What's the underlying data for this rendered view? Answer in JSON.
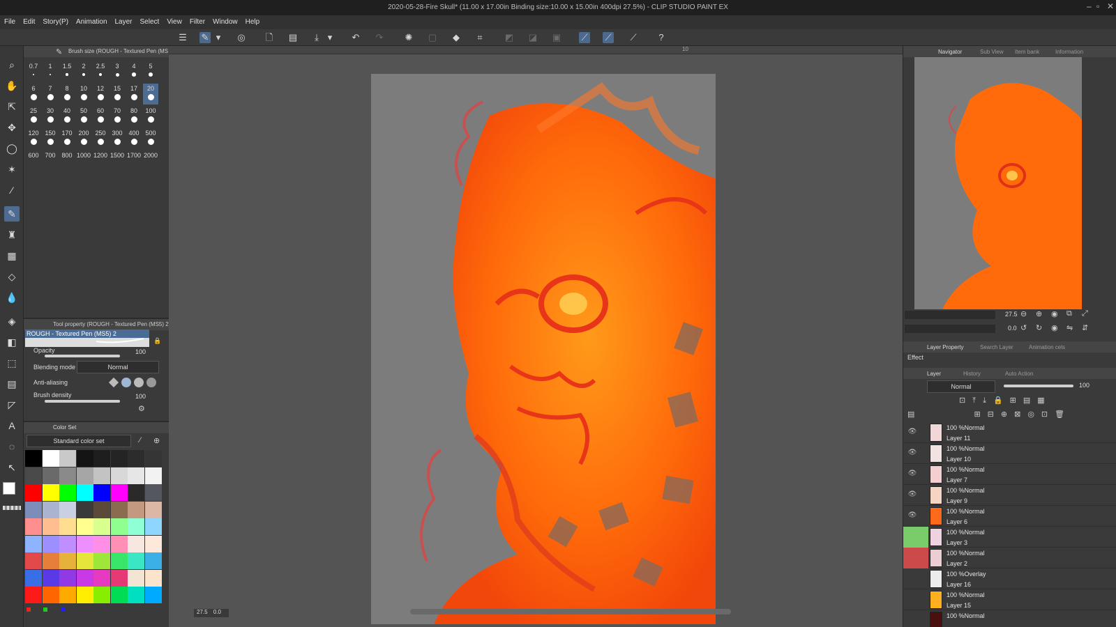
{
  "window": {
    "title": "2020-05-28-Fire Skull* (11.00 x 17.00in Binding size:10.00 x 15.00in 400dpi 27.5%) - CLIP STUDIO PAINT EX"
  },
  "menu": [
    "File",
    "Edit",
    "Story(P)",
    "Animation",
    "Layer",
    "Select",
    "View",
    "Filter",
    "Window",
    "Help"
  ],
  "brush_size_panel": {
    "title": "Brush size (ROUGH - Textured Pen (MS",
    "rows": [
      [
        "0.7",
        "1",
        "1.5",
        "2",
        "2.5",
        "3",
        "4",
        "5"
      ],
      [
        "6",
        "7",
        "8",
        "10",
        "12",
        "15",
        "17",
        "20"
      ],
      [
        "25",
        "30",
        "40",
        "50",
        "60",
        "70",
        "80",
        "100"
      ],
      [
        "120",
        "150",
        "170",
        "200",
        "250",
        "300",
        "400",
        "500"
      ],
      [
        "600",
        "700",
        "800",
        "1000",
        "1200",
        "1500",
        "1700",
        "2000"
      ]
    ],
    "selected": "20"
  },
  "tool_property": {
    "title": "Tool property (ROUGH - Textured Pen (MS5) 2)",
    "brush_name": "ROUGH - Textured Pen (MS5) 2",
    "opacity_label": "Opacity",
    "opacity_value": "100",
    "blending_label": "Blending mode",
    "blending_value": "Normal",
    "antialias_label": "Anti-aliasing",
    "density_label": "Brush density",
    "density_value": "100"
  },
  "color_set": {
    "tab": "Color Set",
    "set_name": "Standard color set",
    "rows": [
      [
        "#000000",
        "#ffffff",
        "#c9c9c9",
        "#141414",
        "#1e1e1e",
        "#242424",
        "#2c2c2c",
        "#353535"
      ],
      [
        "#4a4a4a",
        "#6a6a6a",
        "#8a8a8a",
        "#a6a6a6",
        "#c3c3c3",
        "#d8d8d8",
        "#e6e6e6",
        "#f2f2f2"
      ],
      [
        "#ff0000",
        "#ffff00",
        "#00ff00",
        "#00ffff",
        "#0000ff",
        "#ff00ff",
        "#2a2a2a",
        "#55575e"
      ],
      [
        "#7b8db8",
        "#aab3cf",
        "#c9d0e2",
        "#3a3a3a",
        "#5b4a3a",
        "#8a6c50",
        "#c39a80",
        "#dcb7a6"
      ],
      [
        "#ff8f8f",
        "#ffbe8f",
        "#ffdf8f",
        "#ffff8f",
        "#d9ff8f",
        "#8fff8f",
        "#8fffd6",
        "#8fd6ff"
      ],
      [
        "#8fb4ff",
        "#9d8fff",
        "#c08fff",
        "#ef8fff",
        "#ff8fe6",
        "#ff8fb5",
        "#f8e6e1",
        "#fde8dc"
      ],
      [
        "#e24a4a",
        "#e67f3a",
        "#e6b23a",
        "#e6e63a",
        "#9ee63a",
        "#3ae66a",
        "#3ae6c4",
        "#3ab0e6"
      ],
      [
        "#3a6ee6",
        "#5a3ae6",
        "#903ae6",
        "#c83ae6",
        "#e63ac0",
        "#e63a74",
        "#f4e4d4",
        "#fbe3cc"
      ],
      [
        "#ff1a1a",
        "#ff6600",
        "#ffaa00",
        "#ffee00",
        "#88ee00",
        "#00dd55",
        "#00e0c0",
        "#00aaff"
      ]
    ]
  },
  "canvas": {
    "zoom_readout": "27.5",
    "angle_readout": "0.0",
    "ruler_mark": "10"
  },
  "navigator": {
    "tabs": [
      "Navigator",
      "Sub View",
      "Item bank",
      "Information"
    ],
    "zoom": "27.5",
    "angle": "0.0"
  },
  "layer_property": {
    "tabs": [
      "Layer Property",
      "Search Layer",
      "Animation cels"
    ],
    "effect_label": "Effect"
  },
  "layer_panel": {
    "tabs": [
      "Layer",
      "History",
      "Auto Action"
    ],
    "blend_mode": "Normal",
    "opacity": "100",
    "layers": [
      {
        "mode": "100 %Normal",
        "name": "Layer 11",
        "thumb": "#f0d8d8"
      },
      {
        "mode": "100 %Normal",
        "name": "Layer 10",
        "thumb": "#f2e2e2"
      },
      {
        "mode": "100 %Normal",
        "name": "Layer 7",
        "thumb": "#f3cfcf"
      },
      {
        "mode": "100 %Normal",
        "name": "Layer 9",
        "thumb": "#f6d4c4"
      },
      {
        "mode": "100 %Normal",
        "name": "Layer 6",
        "thumb": "#ff6a1a"
      },
      {
        "mode": "100 %Normal",
        "name": "Layer 3",
        "thumb": "#efd2e0"
      },
      {
        "mode": "100 %Normal",
        "name": "Layer 2",
        "thumb": "#eccdd2"
      },
      {
        "mode": "100 %Overlay",
        "name": "Layer 16",
        "thumb": "#ececec"
      },
      {
        "mode": "100 %Normal",
        "name": "Layer 15",
        "thumb": "#ffb020"
      },
      {
        "mode": "100 %Normal",
        "name": "",
        "thumb": "#4a1010"
      }
    ]
  }
}
